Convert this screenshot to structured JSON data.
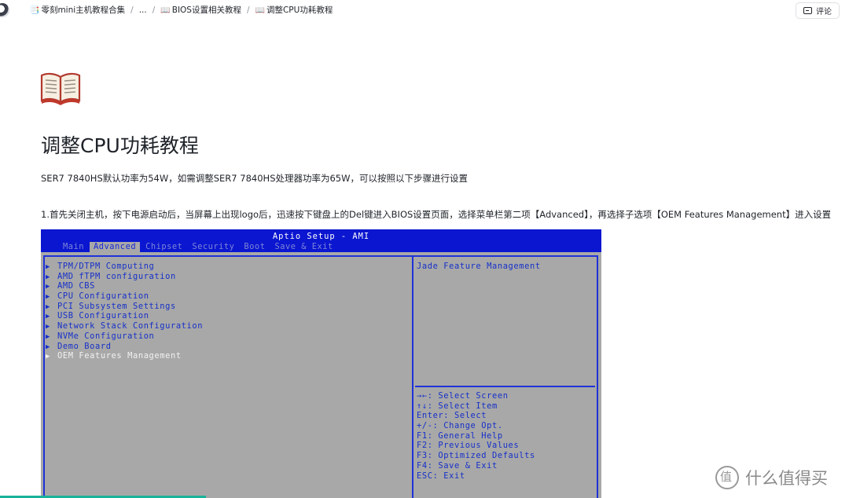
{
  "breadcrumbs": [
    {
      "icon": "📑",
      "label": "零刻mini主机教程合集"
    },
    {
      "icon": "",
      "label": "..."
    },
    {
      "icon": "📖",
      "label": "BIOS设置相关教程"
    },
    {
      "icon": "📖",
      "label": "调整CPU功耗教程"
    }
  ],
  "separator": "/",
  "comment_button": {
    "label": "评论"
  },
  "doc": {
    "icon": "book-icon",
    "title": "调整CPU功耗教程",
    "paragraph1": "SER7 7840HS默认功率为54W，如需调整SER7 7840HS处理器功率为65W，可以按照以下步骤进行设置",
    "paragraph2": "1.首先关闭主机，按下电源启动后，当屏幕上出现logo后，迅速按下键盘上的Del键进入BIOS设置页面，选择菜单栏第二项【Advanced】，再选择子选项【OEM Features Management】进入设置"
  },
  "bios": {
    "title": "Aptio Setup - AMI",
    "tabs": [
      "Main",
      "Advanced",
      "Chipset",
      "Security",
      "Boot",
      "Save & Exit"
    ],
    "active_tab": "Advanced",
    "menu_items": [
      "TPM/DTPM Computing",
      "AMD fTPM configuration",
      "AMD CBS",
      "CPU Configuration",
      "PCI Subsystem Settings",
      "USB Configuration",
      "Network Stack Configuration",
      "NVMe Configuration",
      "Demo Board",
      "OEM Features Management"
    ],
    "selected_item": "OEM Features Management",
    "help_text": "Jade Feature Management",
    "key_help": [
      "→←: Select Screen",
      "↑↓: Select Item",
      "Enter: Select",
      "+/-: Change Opt.",
      "F1: General Help",
      "F2: Previous Values",
      "F3: Optimized Defaults",
      "F4: Save & Exit",
      "ESC: Exit"
    ],
    "colors": {
      "header": "#0a16cf",
      "panel": "#a8a8a8",
      "text": "#1630c8"
    }
  },
  "watermark": {
    "text": "什么值得买"
  }
}
